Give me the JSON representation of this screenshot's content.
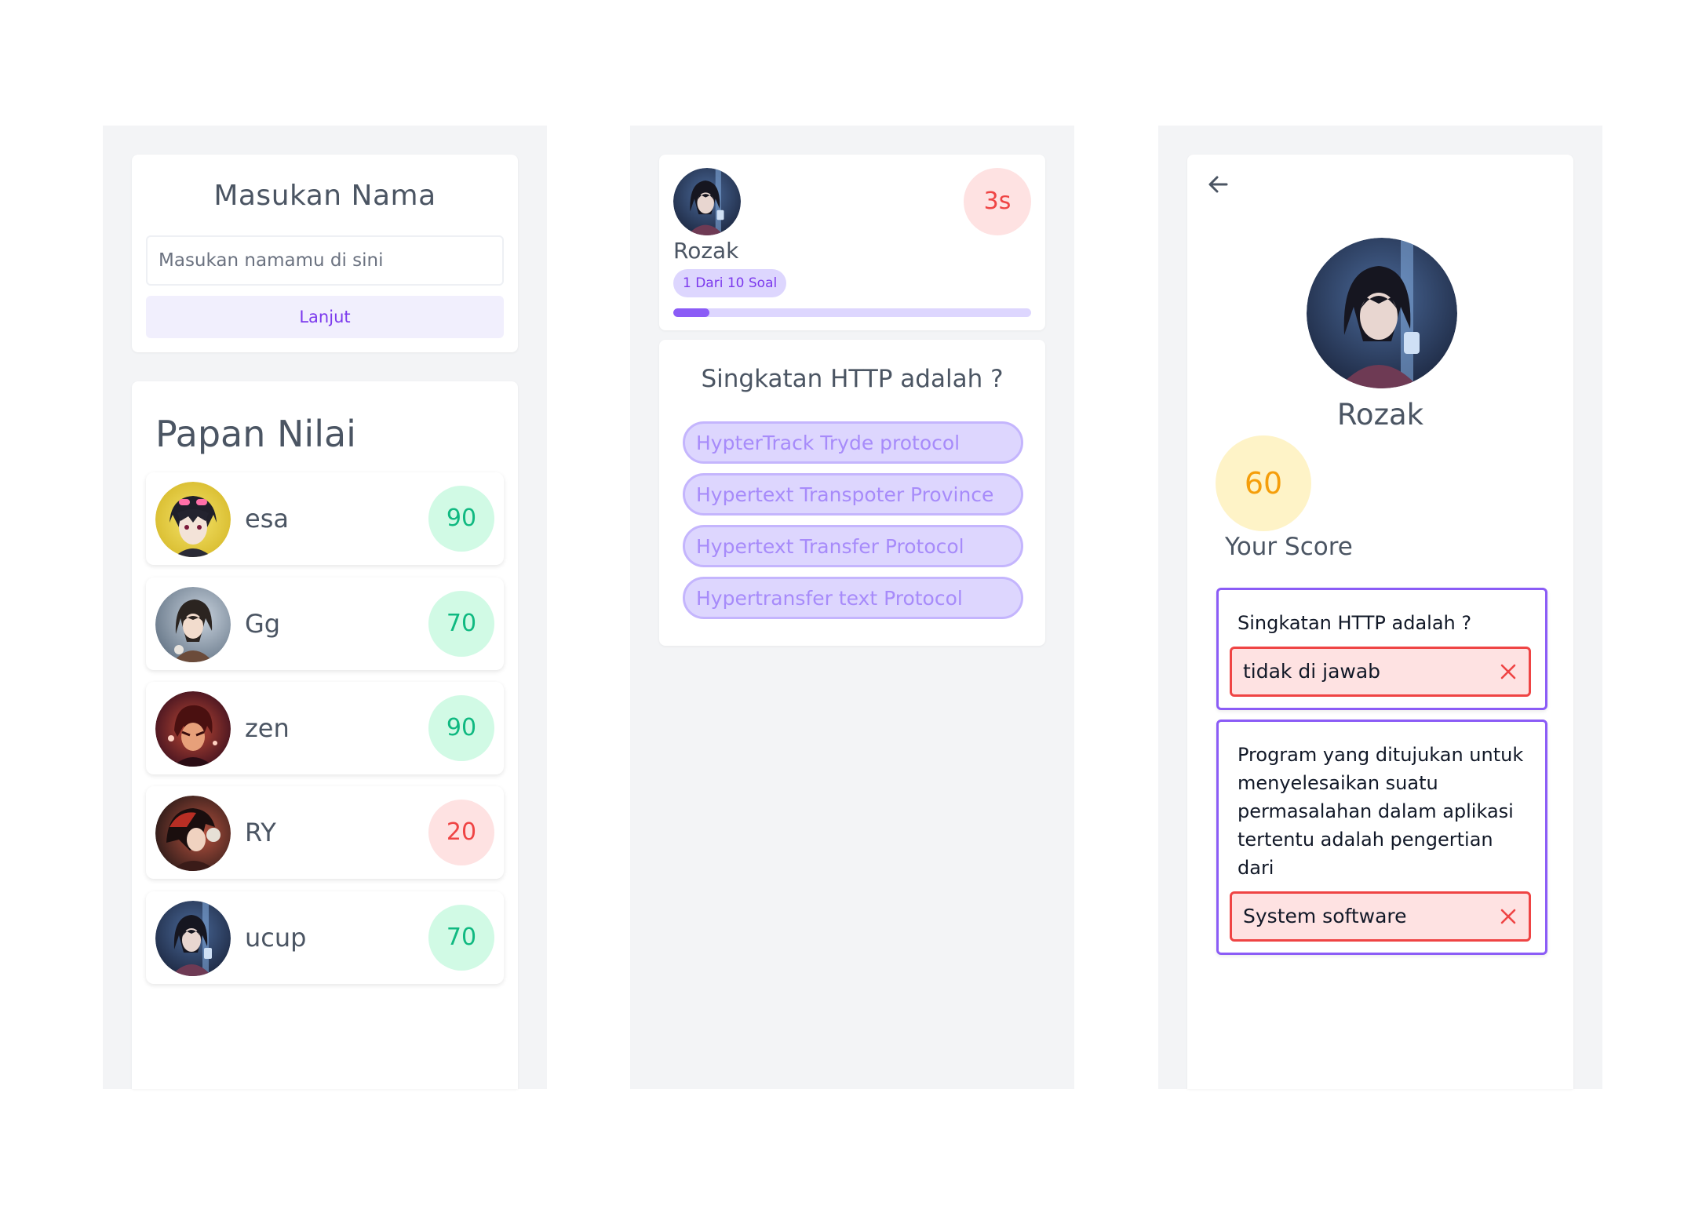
{
  "screen1": {
    "name_card": {
      "title": "Masukan Nama",
      "input_placeholder": "Masukan namamu di sini",
      "input_value": "",
      "continue_label": "Lanjut"
    },
    "leaderboard": {
      "title": "Papan Nilai",
      "entries": [
        {
          "name": "esa",
          "score": "90",
          "status": "good",
          "avatar_icon": "anime-avatar-icon"
        },
        {
          "name": "Gg",
          "score": "70",
          "status": "good",
          "avatar_icon": "anime-avatar-icon"
        },
        {
          "name": "zen",
          "score": "90",
          "status": "good",
          "avatar_icon": "anime-avatar-icon"
        },
        {
          "name": "RY",
          "score": "20",
          "status": "bad",
          "avatar_icon": "anime-avatar-icon"
        },
        {
          "name": "ucup",
          "score": "70",
          "status": "good",
          "avatar_icon": "anime-avatar-icon"
        }
      ]
    }
  },
  "screen2": {
    "player_name": "Rozak",
    "progress_label": "1 Dari 10 Soal",
    "progress_fraction": 0.1,
    "timer": "3s",
    "question": "Singkatan HTTP adalah ?",
    "options": [
      "HypterTrack Tryde protocol",
      "Hypertext Transpoter Province",
      "Hypertext Transfer Protocol",
      "Hypertransfer text Protocol"
    ]
  },
  "screen3": {
    "back_icon": "arrow-left-icon",
    "player_name": "Rozak",
    "score": "60",
    "score_label": "Your Score",
    "answers": [
      {
        "question": "Singkatan HTTP adalah ?",
        "answer": "tidak di jawab",
        "icon": "close-icon"
      },
      {
        "question": "Program yang ditujukan untuk menyelesaikan suatu permasalahan dalam aplikasi tertentu adalah pengertian dari",
        "answer": "System software",
        "icon": "close-icon"
      }
    ]
  },
  "colors": {
    "accent": "#8b5cf6",
    "accent_light": "#ddd6fe",
    "good": "#10b981",
    "bad": "#ef4444",
    "score_gold": "#f59e0b"
  }
}
